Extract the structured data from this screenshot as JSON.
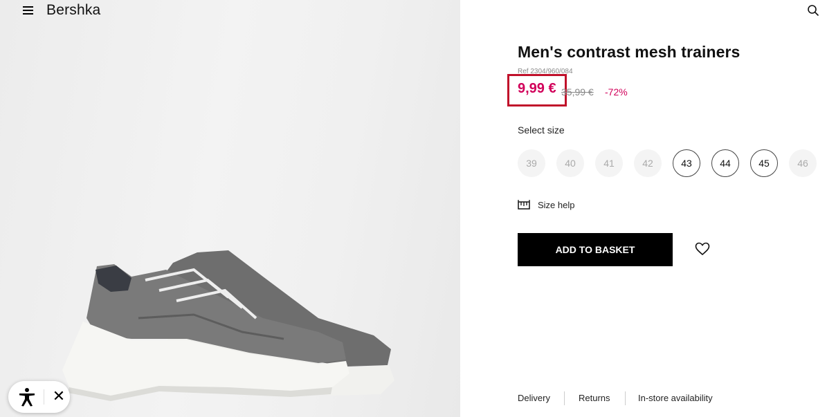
{
  "header": {
    "brand": "Bershka"
  },
  "product": {
    "title": "Men's contrast mesh trainers",
    "ref": "Ref 2304/960/084",
    "price": "9,99 €",
    "old_price": "35,99 €",
    "discount": "-72%"
  },
  "sizes": {
    "label": "Select size",
    "options": [
      {
        "label": "39",
        "available": false
      },
      {
        "label": "40",
        "available": false
      },
      {
        "label": "41",
        "available": false
      },
      {
        "label": "42",
        "available": false
      },
      {
        "label": "43",
        "available": true
      },
      {
        "label": "44",
        "available": true
      },
      {
        "label": "45",
        "available": true
      },
      {
        "label": "46",
        "available": false
      }
    ]
  },
  "size_help": {
    "label": "Size help",
    "icon": "ruler-icon"
  },
  "actions": {
    "add_to_basket": "ADD TO BASKET",
    "wishlist_icon": "heart-icon"
  },
  "footer_links": [
    "Delivery",
    "Returns",
    "In-store availability"
  ],
  "colors": {
    "sale": "#d1005a",
    "highlight_border": "#c0102a",
    "button": "#000000"
  }
}
